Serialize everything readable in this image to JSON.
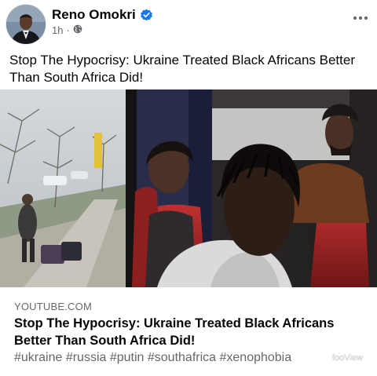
{
  "post": {
    "author_name": "Reno Omokri",
    "timestamp": "1h",
    "separator": "·",
    "text": "Stop The Hypocrisy: Ukraine Treated Black Africans Better Than South Africa Did!"
  },
  "link_preview": {
    "domain": "YOUTUBE.COM",
    "title": "Stop The Hypocrisy: Ukraine Treated Black Africans Better Than South Africa Did!",
    "tags": "#ukraine #russia #putin #southafrica #xenophobia"
  },
  "watermark": "fooView",
  "icons": {
    "verified": "verified-badge-icon",
    "audience": "globe-icon",
    "more": "more-options-icon"
  },
  "colors": {
    "verified_blue": "#1877f2",
    "text_primary": "#050505",
    "text_secondary": "#65676b"
  }
}
